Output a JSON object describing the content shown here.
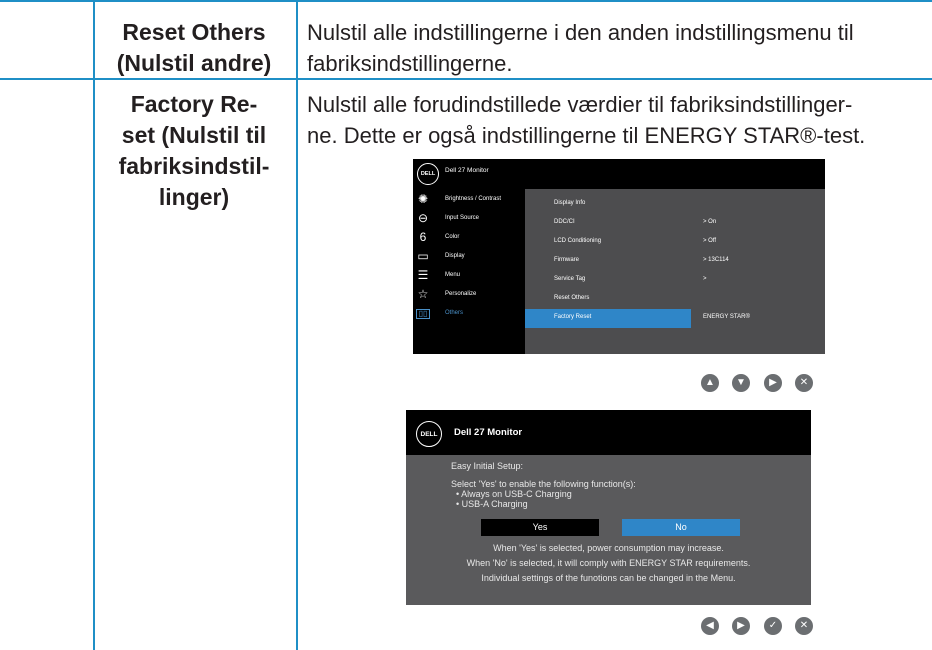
{
  "rows": [
    {
      "label_lines": [
        "Reset Others",
        "(Nulstil andre)"
      ],
      "desc_lines": [
        "Nulstil alle indstillingerne i den anden indstillingsmenu til",
        "fabriksindstillingerne."
      ]
    },
    {
      "label_lines": [
        "Factory Re-",
        "set (Nulstil til",
        "fabriksindstil-",
        "linger)"
      ],
      "desc_lines": [
        "Nulstil alle forudindstillede værdier til fabriksindstillinger-",
        "ne. Dette er også indstillingerne til ENERGY STAR®-test."
      ]
    }
  ],
  "osd": {
    "logo": "DELL",
    "title": "Dell 27 Monitor",
    "menu": [
      {
        "label": "Brightness / Contrast",
        "icon": "brightness-icon"
      },
      {
        "label": "Input Source",
        "icon": "input-source-icon"
      },
      {
        "label": "Color",
        "icon": "color-icon"
      },
      {
        "label": "Display",
        "icon": "display-icon"
      },
      {
        "label": "Menu",
        "icon": "menu-icon"
      },
      {
        "label": "Personalize",
        "icon": "star-icon"
      },
      {
        "label": "Others",
        "icon": "others-icon",
        "active": true
      }
    ],
    "settings": [
      {
        "label": "Display Info",
        "value": ""
      },
      {
        "label": "DDC/CI",
        "value": ">  On"
      },
      {
        "label": "LCD Conditioning",
        "value": ">  Off"
      },
      {
        "label": "Firmware",
        "value": ">  13C114"
      },
      {
        "label": "Service Tag",
        "value": ">"
      },
      {
        "label": "Reset Others",
        "value": ""
      },
      {
        "label": "Factory Reset",
        "value": "ENERGY STAR®",
        "highlight": true
      }
    ],
    "nav_icons": [
      "up-icon",
      "down-icon",
      "right-icon",
      "close-icon"
    ]
  },
  "dialog": {
    "logo": "DELL",
    "title": "Dell 27 Monitor",
    "heading": "Easy Initial Setup:",
    "intro": "Select 'Yes' to enable the following function(s):",
    "bullets": [
      "• Always on USB-C Charging",
      "• USB-A Charging"
    ],
    "yes_label": "Yes",
    "no_label": "No",
    "notes": [
      "When 'Yes' is selected, power consumption may increase.",
      "When 'No' is selected, it will comply with ENERGY STAR requirements.",
      "Individual settings of the funotions can be changed in the Menu."
    ],
    "nav_icons": [
      "left-icon",
      "right-icon",
      "check-icon",
      "close-icon"
    ]
  },
  "colors": {
    "rule": "#1f8fc6",
    "highlight": "#2f86c8",
    "osd_panel": "#4d4d4f"
  }
}
